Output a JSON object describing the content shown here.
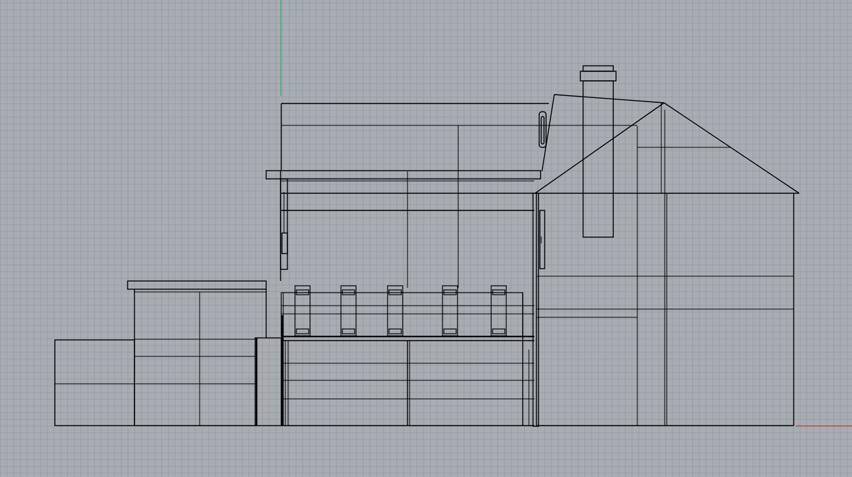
{
  "viewport": {
    "view": "elevation-wireframe",
    "background_color": "#a8adb4",
    "grid_color": "#969ba2",
    "line_color": "#000000",
    "axis_colors": {
      "x_axis": "#c0392b",
      "y_axis": "#27ae60"
    }
  },
  "model": {
    "subject": "house-elevation",
    "parts": [
      "main-gable-house",
      "chimney",
      "upper-rear-roof",
      "porch-roof",
      "porch-columns",
      "porch-railing",
      "lower-porch-wall",
      "left-wing-annex",
      "far-left-shed"
    ]
  }
}
